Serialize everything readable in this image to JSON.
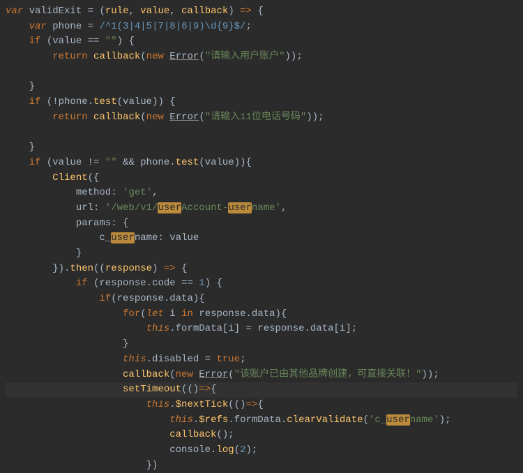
{
  "code": {
    "fn_name": "validExit",
    "params": [
      "rule",
      "value",
      "callback"
    ],
    "phone_regex": "/^1(3|4|5|7|8|6|9)\\d{9}$/",
    "empty_check_lhs": "value",
    "empty_check_rhs": "\"\"",
    "err_msg_empty": "\"请输入用户账户\"",
    "err_msg_phone": "\"请输入11位电话号码\"",
    "client_method_key": "method",
    "client_method_val": "'get'",
    "client_url_key": "url",
    "client_url_val_a": "'/web/v1/",
    "client_url_hl1": "user",
    "client_url_mid": "Account-",
    "client_url_hl2": "user",
    "client_url_end": "name'",
    "client_params_key": "params",
    "client_param_name_pre": "c_",
    "client_param_name_hl": "user",
    "client_param_name_suf": "name",
    "client_param_val": "value",
    "then_arg": "response",
    "resp_code_lhs": "response.code",
    "resp_code_rhs": "1",
    "resp_data": "response.data",
    "loop_var": "i",
    "formData": "formData",
    "assign_rhs": "response.data[i]",
    "disabled_lhs": "disabled",
    "disabled_rhs": "true",
    "err_msg_exist": "\"该账户已由其他品牌创建，可直接关联！\"",
    "nextTick": "$nextTick",
    "refs": "$refs",
    "clearValidate": "clearValidate",
    "cv_arg_pre": "'c_",
    "cv_arg_hl": "user",
    "cv_arg_suf": "name'",
    "log_arg": "2"
  }
}
